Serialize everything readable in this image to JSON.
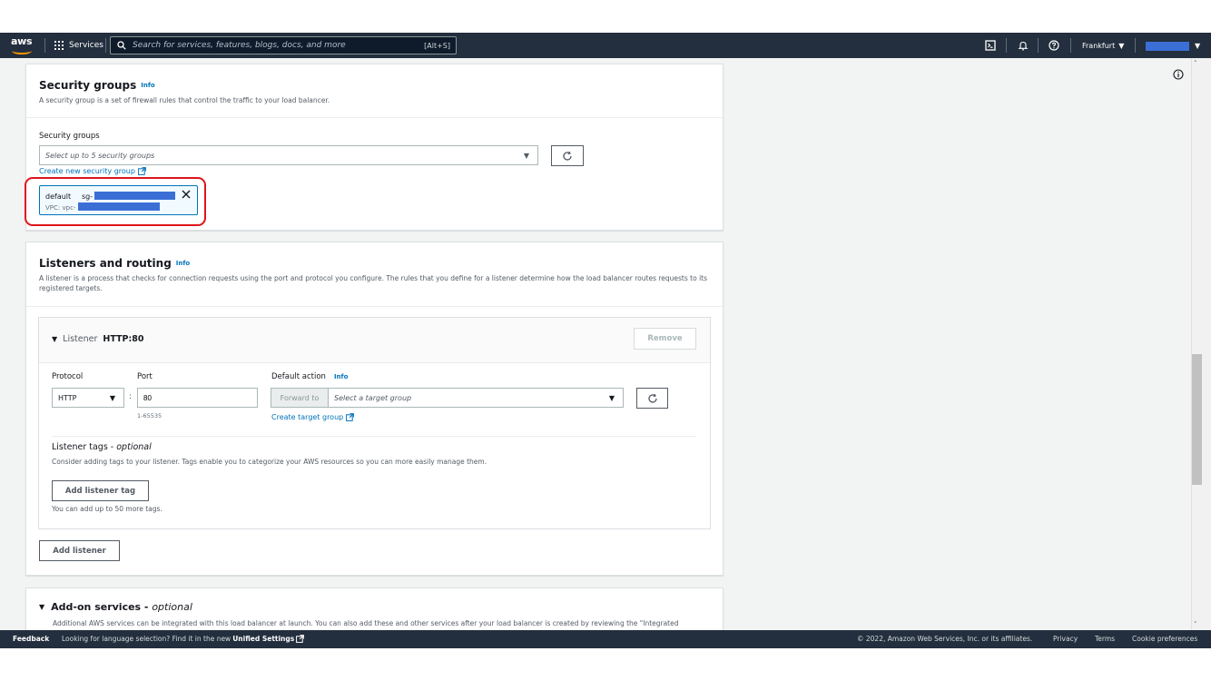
{
  "topnav": {
    "logo_text": "aws",
    "services_label": "Services",
    "search_placeholder": "Search for services, features, blogs, docs, and more",
    "search_shortcut": "[Alt+S]",
    "region_label": "Frankfurt",
    "icons": [
      "cloudshell-icon",
      "bell-icon",
      "help-icon"
    ]
  },
  "security_groups": {
    "title": "Security groups",
    "info": "Info",
    "description": "A security group is a set of firewall rules that control the traffic to your load balancer.",
    "field_label": "Security groups",
    "select_placeholder": "Select up to 5 security groups",
    "create_link": "Create new security group",
    "token": {
      "name": "default",
      "sg_prefix": "sg-",
      "vpc_prefix": "VPC: vpc-"
    }
  },
  "listeners": {
    "title": "Listeners and routing",
    "info": "Info",
    "description": "A listener is a process that checks for connection requests using the port and protocol you configure. The rules that you define for a listener determine how the load balancer routes requests to its registered targets.",
    "listener": {
      "prefix": "Listener",
      "name": "HTTP:80",
      "remove_label": "Remove",
      "protocol_label": "Protocol",
      "protocol_value": "HTTP",
      "port_label": "Port",
      "port_value": "80",
      "port_hint": "1-65535",
      "default_action_label": "Default action",
      "default_action_info": "Info",
      "forward_to_label": "Forward to",
      "target_placeholder": "Select a target group",
      "create_target_link": "Create target group",
      "tags_title": "Listener tags - ",
      "tags_optional": "optional",
      "tags_description": "Consider adding tags to your listener. Tags enable you to categorize your AWS resources so you can more easily manage them.",
      "add_tag_label": "Add listener tag",
      "tags_hint": "You can add up to 50 more tags."
    },
    "add_listener_label": "Add listener"
  },
  "addon": {
    "title": "Add-on services - ",
    "optional": "optional",
    "description": "Additional AWS services can be integrated with this load balancer at launch. You can also add these and other services after your load balancer is created by reviewing the \"Integrated"
  },
  "footer": {
    "feedback": "Feedback",
    "language_text": "Looking for language selection? Find it in the new ",
    "unified_settings": "Unified Settings",
    "copyright": "© 2022, Amazon Web Services, Inc. or its affiliates.",
    "privacy": "Privacy",
    "terms": "Terms",
    "cookies": "Cookie preferences"
  },
  "colors": {
    "nav_bg": "#232f3e",
    "accent_orange": "#ff9900",
    "link_blue": "#0073bb",
    "highlight_red": "#e0141a",
    "redaction_blue": "#3b6fd6"
  }
}
